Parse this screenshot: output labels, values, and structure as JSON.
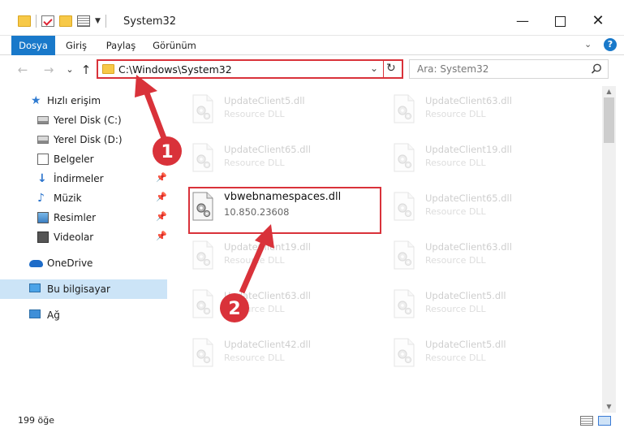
{
  "window": {
    "title": "System32",
    "controls": {
      "minimize": "—",
      "maximize": "",
      "close": "✕"
    }
  },
  "ribbon": {
    "tabs": [
      "Dosya",
      "Giriş",
      "Paylaş",
      "Görünüm"
    ],
    "active_tab": "Dosya",
    "help": "?"
  },
  "navigation": {
    "back": "←",
    "forward": "→",
    "recent": "⌄",
    "up": "↑",
    "address_path": "C:\\Windows\\System32",
    "address_dropdown": "⌄",
    "refresh": "↻",
    "search_placeholder": "Ara: System32"
  },
  "sidebar": {
    "items": [
      {
        "label": "Hızlı erişim",
        "icon": "star-icon",
        "pinned": false
      },
      {
        "label": "Yerel Disk (C:)",
        "icon": "drive-icon",
        "pinned": false
      },
      {
        "label": "Yerel Disk (D:)",
        "icon": "drive-icon",
        "pinned": false
      },
      {
        "label": "Belgeler",
        "icon": "document-icon",
        "pinned": false
      },
      {
        "label": "İndirmeler",
        "icon": "download-icon",
        "pinned": true
      },
      {
        "label": "Müzik",
        "icon": "music-icon",
        "pinned": true
      },
      {
        "label": "Resimler",
        "icon": "pictures-icon",
        "pinned": true
      },
      {
        "label": "Videolar",
        "icon": "video-icon",
        "pinned": true
      },
      {
        "label": "OneDrive",
        "icon": "cloud-icon",
        "pinned": false
      },
      {
        "label": "Bu bilgisayar",
        "icon": "computer-icon",
        "pinned": false,
        "selected": true
      },
      {
        "label": "Ağ",
        "icon": "network-icon",
        "pinned": false
      }
    ]
  },
  "files": {
    "left_column": [
      {
        "name": "UpdateClient5.dll",
        "desc": "Resource DLL"
      },
      {
        "name": "UpdateClient65.dll",
        "desc": "Resource DLL"
      },
      {
        "name": "vbwebnamespaces.dll",
        "desc": "10.850.23608",
        "highlighted": true
      },
      {
        "name": "UpdateClient19.dll",
        "desc": "Resource DLL"
      },
      {
        "name": "UpdateClient63.dll",
        "desc": "Resource DLL"
      },
      {
        "name": "UpdateClient42.dll",
        "desc": "Resource DLL"
      }
    ],
    "right_column": [
      {
        "name": "UpdateClient63.dll",
        "desc": "Resource DLL"
      },
      {
        "name": "UpdateClient19.dll",
        "desc": "Resource DLL"
      },
      {
        "name": "UpdateClient65.dll",
        "desc": "Resource DLL"
      },
      {
        "name": "UpdateClient63.dll",
        "desc": "Resource DLL"
      },
      {
        "name": "UpdateClient5.dll",
        "desc": "Resource DLL"
      },
      {
        "name": "UpdateClient5.dll",
        "desc": "Resource DLL"
      }
    ]
  },
  "status": {
    "item_count": "199 öğe"
  },
  "annotations": {
    "step1": "1",
    "step2": "2",
    "color": "#d9323a"
  },
  "colors": {
    "accent": "#1979ca",
    "selection": "#cce4f7",
    "highlight_border": "#d9323a"
  }
}
